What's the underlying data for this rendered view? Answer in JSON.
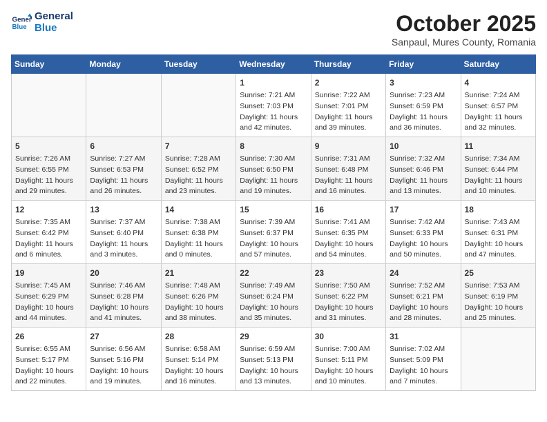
{
  "header": {
    "logo_line1": "General",
    "logo_line2": "Blue",
    "month": "October 2025",
    "location": "Sanpaul, Mures County, Romania"
  },
  "days_of_week": [
    "Sunday",
    "Monday",
    "Tuesday",
    "Wednesday",
    "Thursday",
    "Friday",
    "Saturday"
  ],
  "weeks": [
    [
      {
        "day": "",
        "info": ""
      },
      {
        "day": "",
        "info": ""
      },
      {
        "day": "",
        "info": ""
      },
      {
        "day": "1",
        "info": "Sunrise: 7:21 AM\nSunset: 7:03 PM\nDaylight: 11 hours\nand 42 minutes."
      },
      {
        "day": "2",
        "info": "Sunrise: 7:22 AM\nSunset: 7:01 PM\nDaylight: 11 hours\nand 39 minutes."
      },
      {
        "day": "3",
        "info": "Sunrise: 7:23 AM\nSunset: 6:59 PM\nDaylight: 11 hours\nand 36 minutes."
      },
      {
        "day": "4",
        "info": "Sunrise: 7:24 AM\nSunset: 6:57 PM\nDaylight: 11 hours\nand 32 minutes."
      }
    ],
    [
      {
        "day": "5",
        "info": "Sunrise: 7:26 AM\nSunset: 6:55 PM\nDaylight: 11 hours\nand 29 minutes."
      },
      {
        "day": "6",
        "info": "Sunrise: 7:27 AM\nSunset: 6:53 PM\nDaylight: 11 hours\nand 26 minutes."
      },
      {
        "day": "7",
        "info": "Sunrise: 7:28 AM\nSunset: 6:52 PM\nDaylight: 11 hours\nand 23 minutes."
      },
      {
        "day": "8",
        "info": "Sunrise: 7:30 AM\nSunset: 6:50 PM\nDaylight: 11 hours\nand 19 minutes."
      },
      {
        "day": "9",
        "info": "Sunrise: 7:31 AM\nSunset: 6:48 PM\nDaylight: 11 hours\nand 16 minutes."
      },
      {
        "day": "10",
        "info": "Sunrise: 7:32 AM\nSunset: 6:46 PM\nDaylight: 11 hours\nand 13 minutes."
      },
      {
        "day": "11",
        "info": "Sunrise: 7:34 AM\nSunset: 6:44 PM\nDaylight: 11 hours\nand 10 minutes."
      }
    ],
    [
      {
        "day": "12",
        "info": "Sunrise: 7:35 AM\nSunset: 6:42 PM\nDaylight: 11 hours\nand 6 minutes."
      },
      {
        "day": "13",
        "info": "Sunrise: 7:37 AM\nSunset: 6:40 PM\nDaylight: 11 hours\nand 3 minutes."
      },
      {
        "day": "14",
        "info": "Sunrise: 7:38 AM\nSunset: 6:38 PM\nDaylight: 11 hours\nand 0 minutes."
      },
      {
        "day": "15",
        "info": "Sunrise: 7:39 AM\nSunset: 6:37 PM\nDaylight: 10 hours\nand 57 minutes."
      },
      {
        "day": "16",
        "info": "Sunrise: 7:41 AM\nSunset: 6:35 PM\nDaylight: 10 hours\nand 54 minutes."
      },
      {
        "day": "17",
        "info": "Sunrise: 7:42 AM\nSunset: 6:33 PM\nDaylight: 10 hours\nand 50 minutes."
      },
      {
        "day": "18",
        "info": "Sunrise: 7:43 AM\nSunset: 6:31 PM\nDaylight: 10 hours\nand 47 minutes."
      }
    ],
    [
      {
        "day": "19",
        "info": "Sunrise: 7:45 AM\nSunset: 6:29 PM\nDaylight: 10 hours\nand 44 minutes."
      },
      {
        "day": "20",
        "info": "Sunrise: 7:46 AM\nSunset: 6:28 PM\nDaylight: 10 hours\nand 41 minutes."
      },
      {
        "day": "21",
        "info": "Sunrise: 7:48 AM\nSunset: 6:26 PM\nDaylight: 10 hours\nand 38 minutes."
      },
      {
        "day": "22",
        "info": "Sunrise: 7:49 AM\nSunset: 6:24 PM\nDaylight: 10 hours\nand 35 minutes."
      },
      {
        "day": "23",
        "info": "Sunrise: 7:50 AM\nSunset: 6:22 PM\nDaylight: 10 hours\nand 31 minutes."
      },
      {
        "day": "24",
        "info": "Sunrise: 7:52 AM\nSunset: 6:21 PM\nDaylight: 10 hours\nand 28 minutes."
      },
      {
        "day": "25",
        "info": "Sunrise: 7:53 AM\nSunset: 6:19 PM\nDaylight: 10 hours\nand 25 minutes."
      }
    ],
    [
      {
        "day": "26",
        "info": "Sunrise: 6:55 AM\nSunset: 5:17 PM\nDaylight: 10 hours\nand 22 minutes."
      },
      {
        "day": "27",
        "info": "Sunrise: 6:56 AM\nSunset: 5:16 PM\nDaylight: 10 hours\nand 19 minutes."
      },
      {
        "day": "28",
        "info": "Sunrise: 6:58 AM\nSunset: 5:14 PM\nDaylight: 10 hours\nand 16 minutes."
      },
      {
        "day": "29",
        "info": "Sunrise: 6:59 AM\nSunset: 5:13 PM\nDaylight: 10 hours\nand 13 minutes."
      },
      {
        "day": "30",
        "info": "Sunrise: 7:00 AM\nSunset: 5:11 PM\nDaylight: 10 hours\nand 10 minutes."
      },
      {
        "day": "31",
        "info": "Sunrise: 7:02 AM\nSunset: 5:09 PM\nDaylight: 10 hours\nand 7 minutes."
      },
      {
        "day": "",
        "info": ""
      }
    ]
  ]
}
